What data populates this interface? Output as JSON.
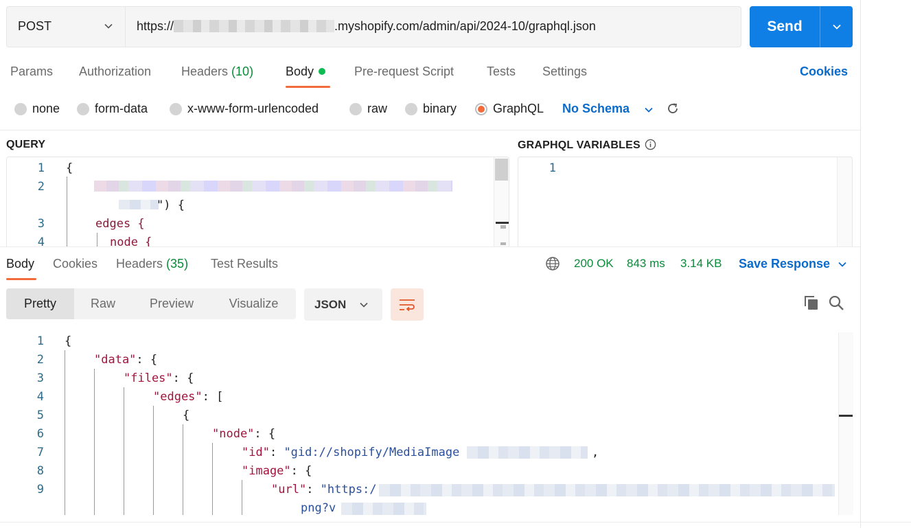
{
  "request": {
    "method": "POST",
    "url_prefix": "https://",
    "url_suffix": ".myshopify.com/admin/api/2024-10/graphql.json",
    "send_label": "Send"
  },
  "request_tabs": [
    {
      "label": "Params"
    },
    {
      "label": "Authorization"
    },
    {
      "label": "Headers ",
      "count": "(10)"
    },
    {
      "label": "Body"
    },
    {
      "label": "Pre-request Script"
    },
    {
      "label": "Tests"
    },
    {
      "label": "Settings"
    }
  ],
  "cookies_label": "Cookies",
  "body_types": [
    "none",
    "form-data",
    "x-www-form-urlencoded",
    "raw",
    "binary",
    "GraphQL"
  ],
  "selected_body_type": "GraphQL",
  "schema_label": "No Schema",
  "query_title": "QUERY",
  "variables_title": "GRAPHQL VARIABLES",
  "query_lines": {
    "l1": "{",
    "l2_tail": "\") {",
    "l3": "edges {",
    "l4": "node {"
  },
  "variables_line": "1",
  "response_tabs": [
    {
      "label": "Body"
    },
    {
      "label": "Cookies"
    },
    {
      "label": "Headers ",
      "count": "(35)"
    },
    {
      "label": "Test Results"
    }
  ],
  "response_status": {
    "code": "200 OK",
    "time": "843 ms",
    "size": "3.14 KB"
  },
  "save_response_label": "Save Response",
  "view_modes": [
    "Pretty",
    "Raw",
    "Preview",
    "Visualize"
  ],
  "format_label": "JSON",
  "response_lines": {
    "l1": "{",
    "l2_key": "\"data\"",
    "l3_key": "\"files\"",
    "l4_key": "\"edges\"",
    "l5": "{",
    "l6_key": "\"node\"",
    "l7_key": "\"id\"",
    "l7_val": "\"gid://shopify/MediaImage",
    "l8_key": "\"image\"",
    "l9_key": "\"url\"",
    "l9_val": "\"https:/",
    "l9b": "png?v"
  },
  "line_numbers": [
    "1",
    "2",
    "3",
    "4",
    "5",
    "6",
    "7",
    "8",
    "9"
  ]
}
